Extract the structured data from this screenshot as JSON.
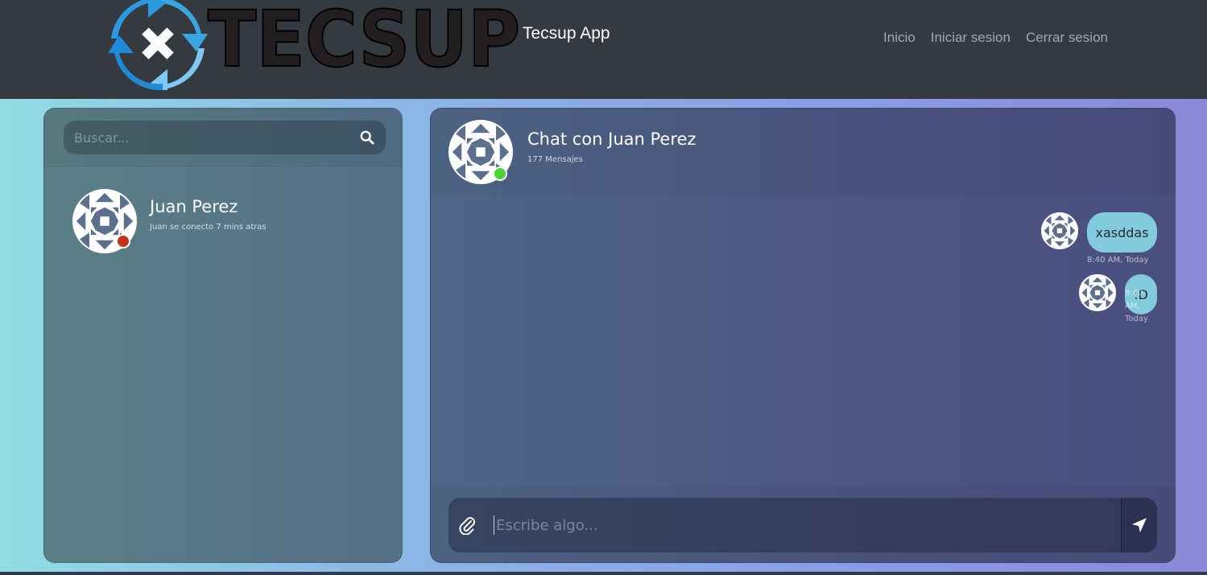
{
  "navbar": {
    "logo_text": "TECSUP",
    "brand": "Tecsup App",
    "links": [
      "Inicio",
      "Iniciar sesion",
      "Cerrar sesion"
    ]
  },
  "sidebar": {
    "search_placeholder": "Buscar...",
    "contacts": [
      {
        "name": "Juan Perez",
        "status": "Juan se conecto 7 mins atras",
        "online": false
      }
    ]
  },
  "chat": {
    "title": "Chat con Juan Perez",
    "count": "177 Mensajes",
    "online": true,
    "messages": [
      {
        "text": "xasddas",
        "time": "8:40 AM, Today"
      },
      {
        "text": ":D",
        "time": "8:40 AM, Today"
      }
    ],
    "input_placeholder": "Escribe algo..."
  },
  "colors": {
    "navbar": "#343a40",
    "bubble": "#83cadd",
    "online": "#4cd137",
    "offline": "#c23616"
  }
}
